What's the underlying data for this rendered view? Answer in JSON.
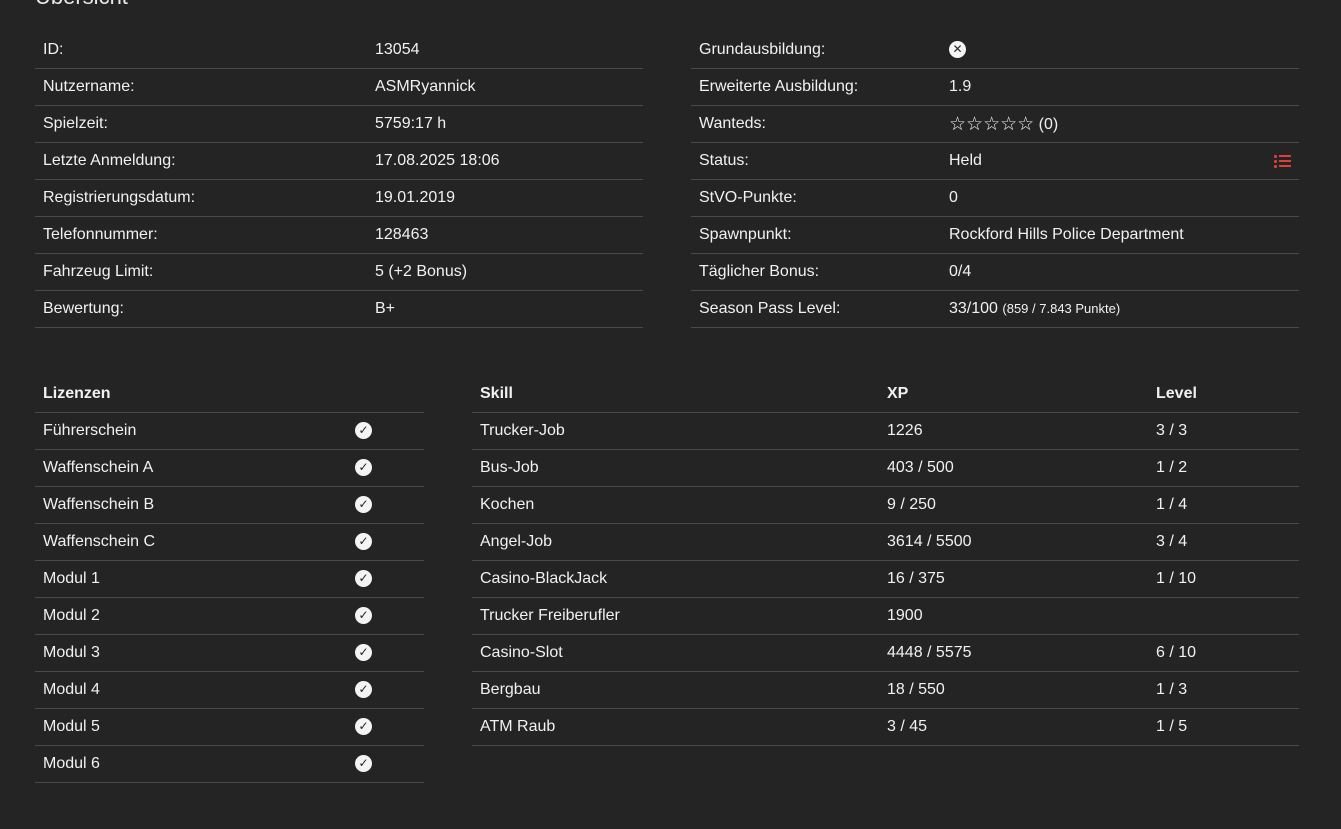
{
  "page": {
    "title": "Übersicht"
  },
  "general": [
    {
      "label": "ID:",
      "value": "13054"
    },
    {
      "label": "Nutzername:",
      "value": "ASMRyannick"
    },
    {
      "label": "Spielzeit:",
      "value": "5759:17 h"
    },
    {
      "label": "Letzte Anmeldung:",
      "value": "17.08.2025 18:06"
    },
    {
      "label": "Registrierungsdatum:",
      "value": "19.01.2019"
    },
    {
      "label": "Telefonnummer:",
      "value": "128463"
    },
    {
      "label": "Fahrzeug Limit:",
      "value": "5 (+2 Bonus)"
    },
    {
      "label": "Bewertung:",
      "value": "B+"
    }
  ],
  "account": {
    "basic_training": {
      "label": "Grundausbildung:",
      "icon": "x-circle-icon"
    },
    "advanced_training": {
      "label": "Erweiterte Ausbildung:",
      "value": "1.9"
    },
    "wanteds": {
      "label": "Wanteds:",
      "stars": "☆☆☆☆☆",
      "star_count": 0,
      "star_max": 5,
      "count_text": "(0)"
    },
    "status": {
      "label": "Status:",
      "value": "Held",
      "action_icon": "list-icon",
      "action_color": "#d9413a"
    },
    "stvo_points": {
      "label": "StVO-Punkte:",
      "value": "0"
    },
    "spawn": {
      "label": "Spawnpunkt:",
      "value": "Rockford Hills Police Department"
    },
    "daily_bonus": {
      "label": "Täglicher Bonus:",
      "value": "0/4"
    },
    "season_pass": {
      "label": "Season Pass Level:",
      "value": "33/100",
      "points": "(859 / 7.843 Punkte)"
    }
  },
  "licenses": {
    "header": "Lizenzen",
    "items": [
      {
        "name": "Führerschein",
        "icon": "check-circle-icon"
      },
      {
        "name": "Waffenschein A",
        "icon": "check-circle-icon"
      },
      {
        "name": "Waffenschein B",
        "icon": "check-circle-icon"
      },
      {
        "name": "Waffenschein C",
        "icon": "check-circle-icon"
      },
      {
        "name": "Modul 1",
        "icon": "check-circle-icon"
      },
      {
        "name": "Modul 2",
        "icon": "check-circle-icon"
      },
      {
        "name": "Modul 3",
        "icon": "check-circle-icon"
      },
      {
        "name": "Modul 4",
        "icon": "check-circle-icon"
      },
      {
        "name": "Modul 5",
        "icon": "check-circle-icon"
      },
      {
        "name": "Modul 6",
        "icon": "check-circle-icon"
      }
    ]
  },
  "skills": {
    "headers": [
      "Skill",
      "XP",
      "Level"
    ],
    "rows": [
      {
        "skill": "Trucker-Job",
        "xp": "1226",
        "level": "3 / 3"
      },
      {
        "skill": "Bus-Job",
        "xp": "403 / 500",
        "level": "1 / 2"
      },
      {
        "skill": "Kochen",
        "xp": "9 / 250",
        "level": "1 / 4"
      },
      {
        "skill": "Angel-Job",
        "xp": "3614 / 5500",
        "level": "3 / 4"
      },
      {
        "skill": "Casino-BlackJack",
        "xp": "16 / 375",
        "level": "1 / 10"
      },
      {
        "skill": "Trucker Freiberufler",
        "xp": "1900",
        "level": ""
      },
      {
        "skill": "Casino-Slot",
        "xp": "4448 / 5575",
        "level": "6 / 10"
      },
      {
        "skill": "Bergbau",
        "xp": "18 / 550",
        "level": "1 / 3"
      },
      {
        "skill": "ATM Raub",
        "xp": "3 / 45",
        "level": "1 / 5"
      }
    ]
  },
  "theme": {
    "background": "#242424",
    "text": "#f1f1f1",
    "divider": "#4a4a4a",
    "accent_red": "#d9413a"
  }
}
